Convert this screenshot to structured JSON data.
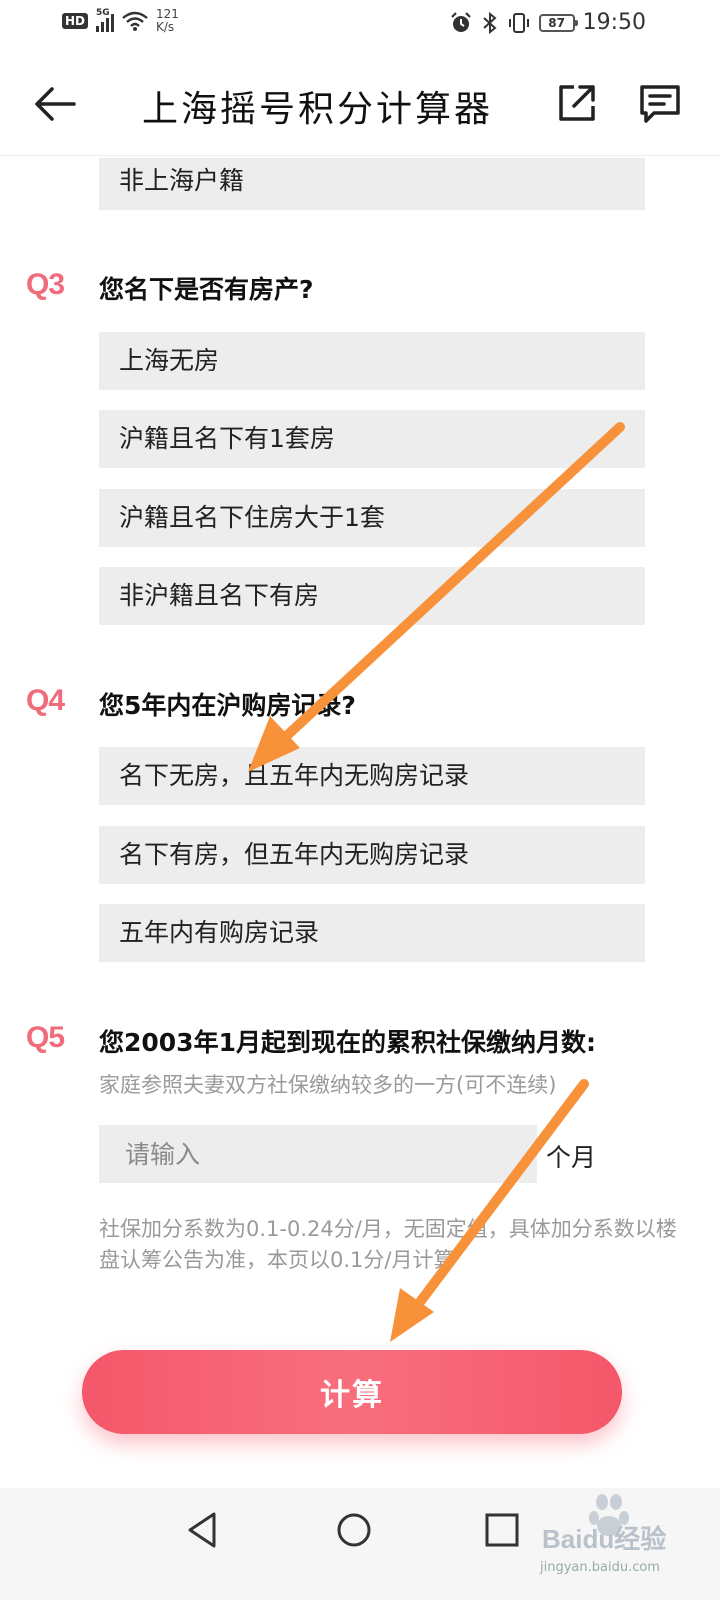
{
  "status_bar": {
    "hd": "HD",
    "network": "5G",
    "speed_value": "121",
    "speed_unit": "K/s",
    "battery": "87",
    "time": "19:50"
  },
  "app_bar": {
    "title": "上海摇号积分计算器",
    "back_icon": "arrow-left-icon",
    "share_icon": "share-icon",
    "feedback_icon": "feedback-icon"
  },
  "q2_partial": {
    "options": [
      "非上海户籍"
    ]
  },
  "q3": {
    "number": "Q3",
    "question": "您名下是否有房产?",
    "options": [
      "上海无房",
      "沪籍且名下有1套房",
      "沪籍且名下住房大于1套",
      "非沪籍且名下有房"
    ]
  },
  "q4": {
    "number": "Q4",
    "question": "您5年内在沪购房记录?",
    "options": [
      "名下无房，且五年内无购房记录",
      "名下有房，但五年内无购房记录",
      "五年内有购房记录"
    ]
  },
  "q5": {
    "number": "Q5",
    "question": "您2003年1月起到现在的累积社保缴纳月数:",
    "hint": "家庭参照夫妻双方社保缴纳较多的一方(可不连续)",
    "input_placeholder": "请输入",
    "input_unit": "个月",
    "note": "社保加分系数为0.1-0.24分/月，无固定值，具体加分系数以楼盘认筹公告为准，本页以0.1分/月计算"
  },
  "calculate_button": "计算",
  "nav_bar": {
    "back": "triangle-back-icon",
    "home": "circle-home-icon",
    "recents": "square-recents-icon"
  },
  "watermark": {
    "text": "Baidu经验",
    "url": "jingyan.baidu.com"
  },
  "colors": {
    "accent": "#f4586a",
    "question_number": "#f06b7c",
    "option_bg": "#ededed",
    "annotation_arrow": "#f7923a"
  }
}
